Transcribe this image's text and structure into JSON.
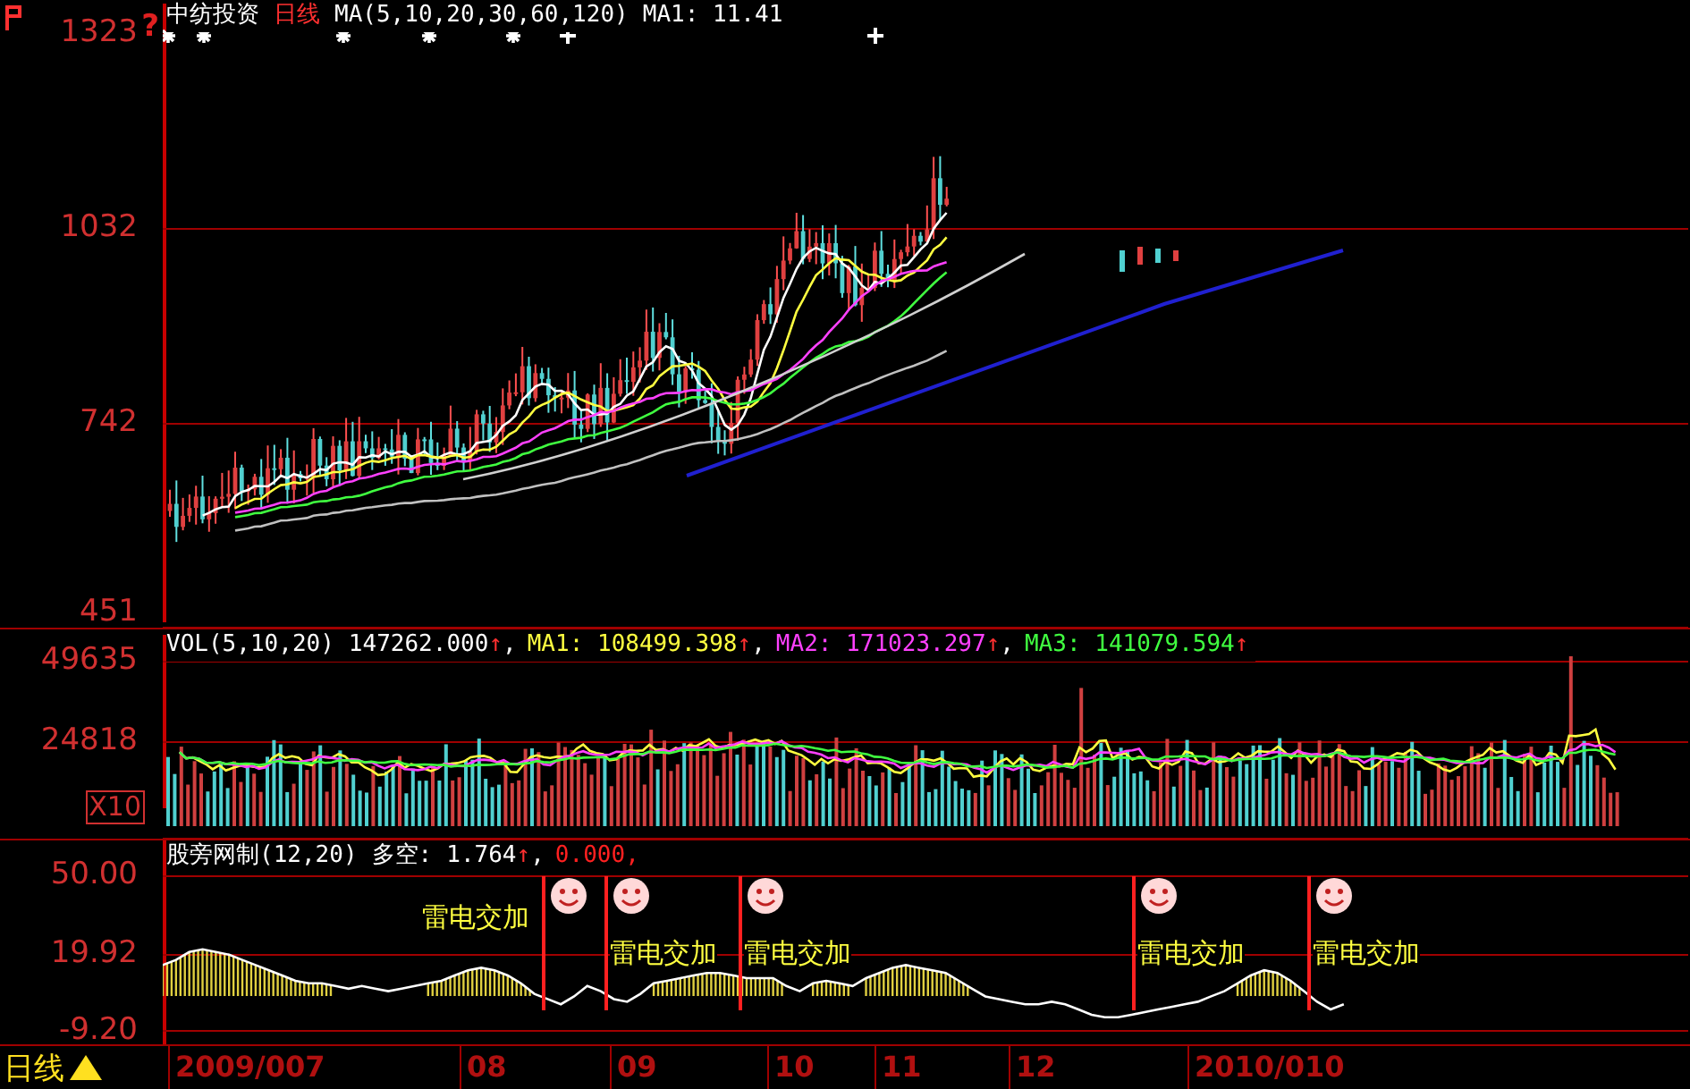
{
  "price_panel": {
    "title": "中纺投资",
    "period": "日线",
    "indicator": "MA(5,10,20,30,60,120)",
    "reading": "MA1: 11.41",
    "axis_labels": [
      "1323",
      "1032",
      "742",
      "451"
    ],
    "axis_mark": "?",
    "marks": [
      {
        "kind": "star"
      },
      {
        "kind": "star"
      },
      {
        "kind": "star"
      },
      {
        "kind": "star"
      },
      {
        "kind": "star"
      },
      {
        "kind": "plus"
      },
      {
        "kind": "plus"
      }
    ]
  },
  "volume_panel": {
    "title": "VOL(5,10,20)",
    "readings": [
      {
        "text": "147262.000",
        "arrow": "↑",
        "separator": ",",
        "color": "#ffffff"
      },
      {
        "text": "MA1: 108499.398",
        "arrow": "↑",
        "separator": ",",
        "color": "#ffff40"
      },
      {
        "text": "MA2: 171023.297",
        "arrow": "↑",
        "separator": ",",
        "color": "#ff40ff"
      },
      {
        "text": "MA3: 141079.594",
        "arrow": "↑",
        "color": "#40ff40"
      }
    ],
    "axis_labels": [
      "49635",
      "24818"
    ],
    "unit": "X10"
  },
  "indicator_panel": {
    "title": "股旁网制(12,20)",
    "label": "多空:",
    "readings": [
      {
        "text": "1.764",
        "arrow": "↑",
        "separator": ",",
        "color": "#ffffff"
      },
      {
        "text": "0.000",
        "separator": ",",
        "color": "#ff2020"
      }
    ],
    "chart_data": {
      "type": "line",
      "ylim": [
        -15,
        63.7
      ],
      "grid": true,
      "yticks": [
        {
          "value": 50,
          "label": "50.00"
        },
        {
          "value": 19.92,
          "label": "19.92"
        },
        {
          "value": -9.2,
          "label": "-9.20"
        }
      ],
      "values": [
        16,
        18,
        21,
        22,
        21,
        20,
        18,
        16,
        14,
        12,
        10,
        9,
        9,
        8,
        7,
        8,
        7,
        6,
        7,
        8,
        9,
        10,
        12,
        14,
        15,
        14,
        12,
        9,
        5,
        3,
        1,
        4,
        8,
        6,
        3,
        2,
        5,
        9,
        10,
        11,
        12,
        13,
        13,
        12,
        11,
        11,
        11,
        8,
        6,
        9,
        10,
        9,
        8,
        11,
        13,
        15,
        16,
        15,
        14,
        13,
        10,
        7,
        4,
        3,
        2,
        1,
        1,
        2,
        1,
        -1,
        -3,
        -4,
        -4,
        -3,
        -2,
        -1,
        0,
        1,
        2,
        4,
        6,
        9,
        12,
        14,
        13,
        10,
        6,
        2,
        -1,
        1
      ]
    },
    "signals": [
      {
        "label": "雷电交加"
      },
      {
        "label": "雷电交加"
      },
      {
        "label": "雷电交加"
      },
      {
        "label": "雷电交加"
      },
      {
        "label": "雷电交加"
      }
    ]
  },
  "date_axis": {
    "period": "日线",
    "dates": [
      "2009/007",
      "08",
      "09",
      "10",
      "11",
      "12",
      "2010/010"
    ]
  }
}
